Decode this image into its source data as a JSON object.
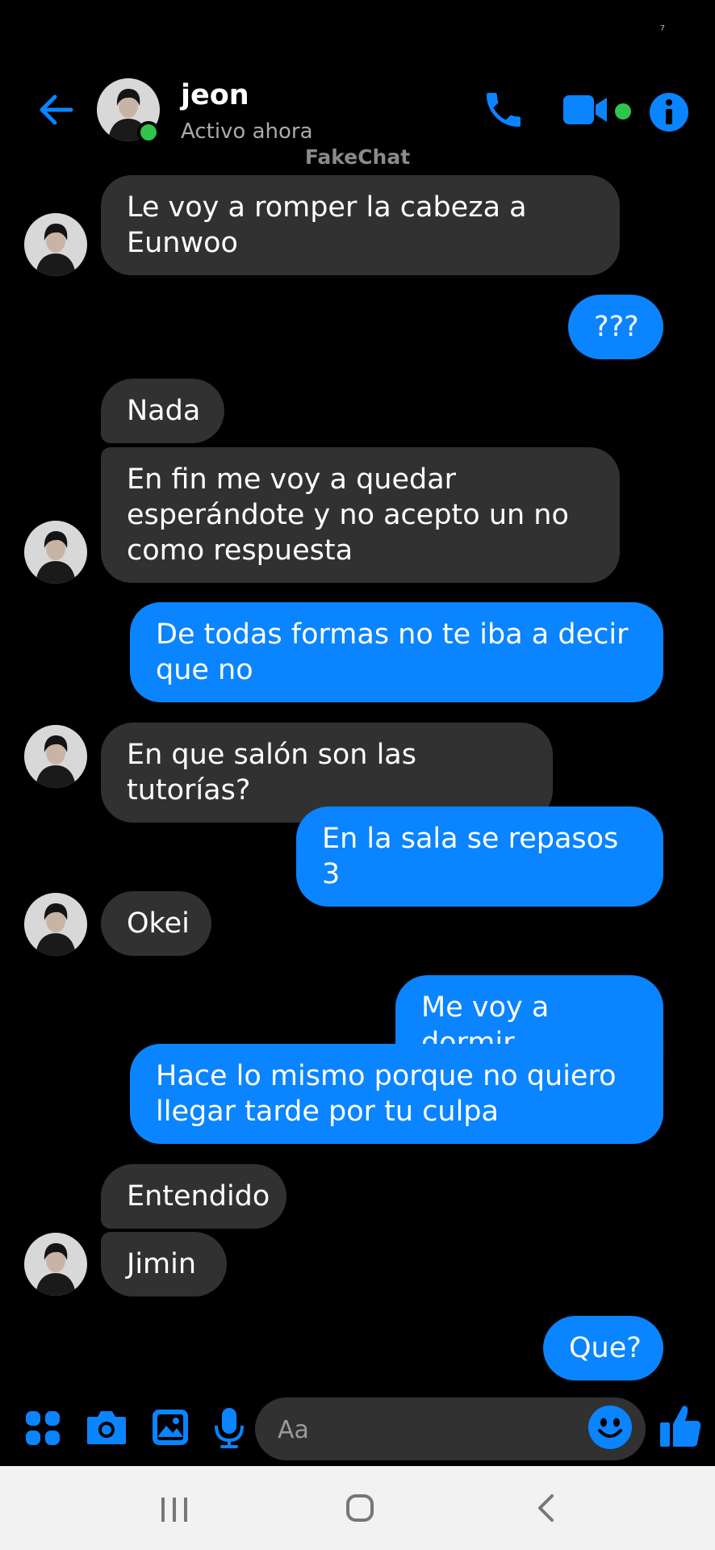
{
  "status_bar": {
    "indicator": "⁷"
  },
  "header": {
    "contact_name": "jeon",
    "contact_status": "Activo ahora",
    "watermark": "FakeChat",
    "icons": [
      "back-arrow-icon",
      "phone-icon",
      "video-camera-icon",
      "info-icon"
    ]
  },
  "messages": [
    {
      "side": "in",
      "text": "Le voy a romper la cabeza a Eunwoo"
    },
    {
      "side": "out",
      "text": "???"
    },
    {
      "side": "in",
      "text": "Nada"
    },
    {
      "side": "in",
      "text": "En fin me voy a quedar esperándote y no acepto un no como respuesta"
    },
    {
      "side": "out",
      "text": "De todas formas no te iba a decir que no"
    },
    {
      "side": "in",
      "text": "En que salón son las tutorías?"
    },
    {
      "side": "out",
      "text": "En la sala se repasos 3"
    },
    {
      "side": "in",
      "text": "Okei"
    },
    {
      "side": "out",
      "text": "Me voy a dormir"
    },
    {
      "side": "out",
      "text": "Hace lo mismo porque no quiero llegar tarde por tu culpa"
    },
    {
      "side": "in",
      "text": "Entendido"
    },
    {
      "side": "in",
      "text": "Jimin"
    },
    {
      "side": "out",
      "text": "Que?"
    }
  ],
  "composer": {
    "placeholder": "Aa",
    "icons": [
      "apps-icon",
      "camera-icon",
      "gallery-icon",
      "microphone-icon",
      "emoji-icon",
      "thumbs-up-icon"
    ]
  },
  "nav_bar": {
    "icons": [
      "recents-icon",
      "home-icon",
      "back-icon"
    ]
  },
  "colors": {
    "accent": "#0a84ff",
    "incoming": "#313131",
    "online": "#31c44a",
    "background": "#000000"
  }
}
